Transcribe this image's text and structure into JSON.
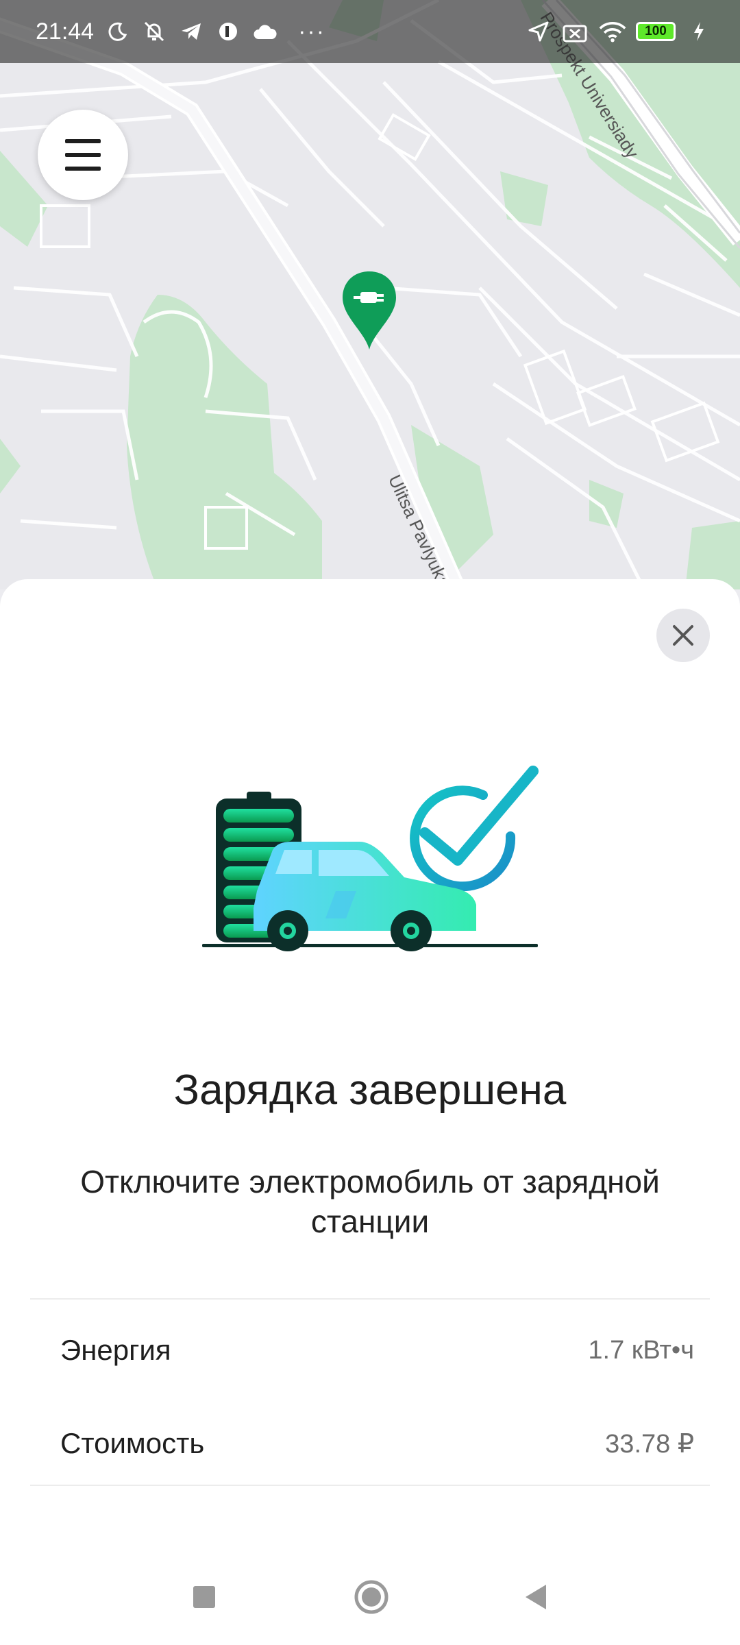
{
  "status_bar": {
    "time": "21:44",
    "battery_level": "100",
    "more_indicator": "···"
  },
  "map": {
    "street_label": "Ulitsa Pavlyuka",
    "avenue_label": "Prospekt Universiady",
    "pin_color": "#0f9d58"
  },
  "sheet": {
    "title": "Зарядка завершена",
    "subtitle": "Отключите электромобиль от зарядной станции",
    "rows": [
      {
        "label": "Энергия",
        "value": "1.7 кВт•ч"
      },
      {
        "label": "Стоимость",
        "value": "33.78 ₽"
      }
    ]
  },
  "icons": {
    "menu": "hamburger-icon",
    "close": "close-icon",
    "pin": "charging-station-pin-icon",
    "nav": [
      "recents-square-icon",
      "home-circle-icon",
      "back-triangle-icon"
    ]
  }
}
